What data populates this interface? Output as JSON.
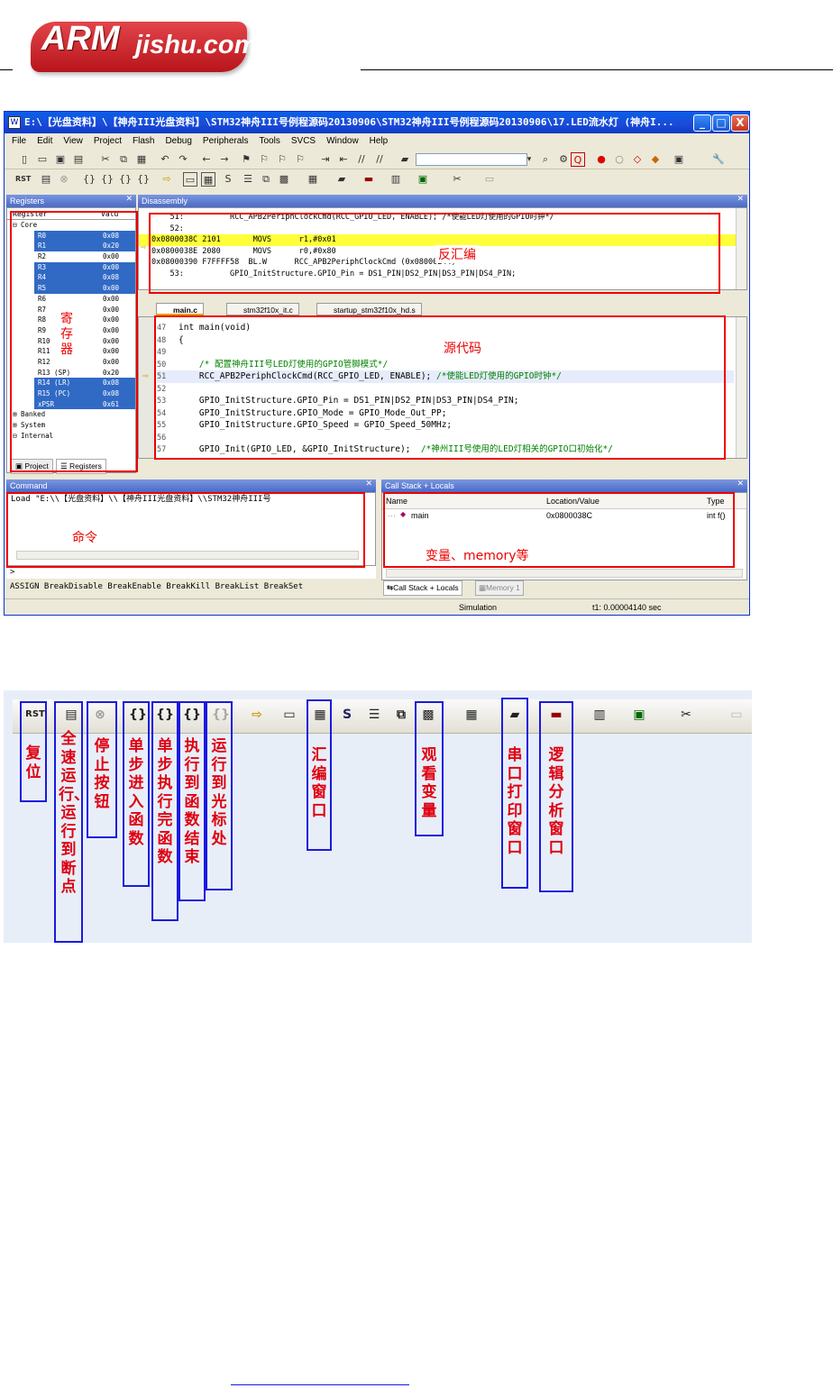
{
  "logo": {
    "arm": "ARM",
    "site": "jishu.com"
  },
  "window": {
    "title": "E:\\【光盘资料】\\【神舟III光盘资料】\\STM32神舟III号例程源码20130906\\STM32神舟III号例程源码20130906\\17.LED流水灯 (神舟I...",
    "buttons": [
      "_",
      "□",
      "X"
    ]
  },
  "menu": [
    "File",
    "Edit",
    "View",
    "Project",
    "Flash",
    "Debug",
    "Peripherals",
    "Tools",
    "SVCS",
    "Window",
    "Help"
  ],
  "registers": {
    "pane_title": "Registers",
    "col_register": "Register",
    "col_value": "Valu",
    "groups": [
      "Core",
      "Banked",
      "System",
      "Internal"
    ],
    "rows": [
      {
        "n": "R0",
        "v": "0x08",
        "sel": true
      },
      {
        "n": "R1",
        "v": "0x20",
        "sel": true
      },
      {
        "n": "R2",
        "v": "0x00",
        "sel": false
      },
      {
        "n": "R3",
        "v": "0x00",
        "sel": true
      },
      {
        "n": "R4",
        "v": "0x08",
        "sel": true
      },
      {
        "n": "R5",
        "v": "0x00",
        "sel": true
      },
      {
        "n": "R6",
        "v": "0x00",
        "sel": false
      },
      {
        "n": "R7",
        "v": "0x00",
        "sel": false
      },
      {
        "n": "R8",
        "v": "0x00",
        "sel": false
      },
      {
        "n": "R9",
        "v": "0x00",
        "sel": false
      },
      {
        "n": "R10",
        "v": "0x00",
        "sel": false
      },
      {
        "n": "R11",
        "v": "0x00",
        "sel": false
      },
      {
        "n": "R12",
        "v": "0x00",
        "sel": false
      },
      {
        "n": "R13 (SP)",
        "v": "0x20",
        "sel": false
      },
      {
        "n": "R14 (LR)",
        "v": "0x08",
        "sel": true
      },
      {
        "n": "R15 (PC)",
        "v": "0x08",
        "sel": true
      },
      {
        "n": "xPSR",
        "v": "0x61",
        "sel": true
      }
    ],
    "tab_project": "Project",
    "tab_registers": "Registers",
    "annotation": "寄存器"
  },
  "disassembly": {
    "pane_title": "Disassembly",
    "lines": [
      "    51:          RCC_APB2PeriphClockCmd(RCC_GPIO_LED, ENABLE); /*使能LED灯使用的GPIO时钟*/",
      "    52:",
      "0x0800038C 2101       MOVS      r1,#0x01",
      "0x0800038E 2080       MOVS      r0,#0x80",
      "0x08000390 F7FFFF58  BL.W      RCC_APB2PeriphClockCmd (0x08000244)",
      "    53:          GPIO_InitStructure.GPIO_Pin = DS1_PIN|DS2_PIN|DS3_PIN|DS4_PIN;"
    ],
    "annotation": "反汇编"
  },
  "editor": {
    "tabs": [
      "main.c",
      "stm32f10x_it.c",
      "startup_stm32f10x_hd.s"
    ],
    "lines": [
      {
        "n": "47",
        "t": "int main(void)",
        "c": ""
      },
      {
        "n": "48",
        "t": "{",
        "c": ""
      },
      {
        "n": "49",
        "t": "",
        "c": ""
      },
      {
        "n": "50",
        "t": "    ",
        "c": "/* 配置神舟III号LED灯使用的GPIO管脚模式*/"
      },
      {
        "n": "51",
        "t": "    RCC_APB2PeriphClockCmd(RCC_GPIO_LED, ENABLE); ",
        "c": "/*使能LED灯使用的GPIO时钟*/"
      },
      {
        "n": "52",
        "t": "",
        "c": ""
      },
      {
        "n": "53",
        "t": "    GPIO_InitStructure.GPIO_Pin = DS1_PIN|DS2_PIN|DS3_PIN|DS4_PIN;",
        "c": ""
      },
      {
        "n": "54",
        "t": "    GPIO_InitStructure.GPIO_Mode = GPIO_Mode_Out_PP;",
        "c": ""
      },
      {
        "n": "55",
        "t": "    GPIO_InitStructure.GPIO_Speed = GPIO_Speed_50MHz;",
        "c": ""
      },
      {
        "n": "56",
        "t": "",
        "c": ""
      },
      {
        "n": "57",
        "t": "    GPIO_Init(GPIO_LED, &GPIO_InitStructure);  ",
        "c": "/*神州III号使用的LED灯相关的GPIO口初始化*/"
      }
    ],
    "annotation": "源代码"
  },
  "command": {
    "pane_title": "Command",
    "load_line": "Load \"E:\\\\【光盘资料】\\\\【神舟III光盘资料】\\\\STM32神舟III号",
    "prompt": ">",
    "hints": "ASSIGN BreakDisable BreakEnable BreakKill BreakList BreakSet",
    "annotation": "命令"
  },
  "callstack": {
    "pane_title": "Call Stack + Locals",
    "cols": [
      "Name",
      "Location/Value",
      "Type"
    ],
    "row": {
      "name": "main",
      "value": "0x0800038C",
      "type": "int f()"
    },
    "tab_callstack": "Call Stack + Locals",
    "tab_memory": "Memory 1",
    "annotation": "变量、memory等"
  },
  "statusbar": {
    "mode": "Simulation",
    "time": "t1: 0.00004140 sec"
  },
  "toolbar_figure": {
    "icons": [
      "reset-icon",
      "run-icon",
      "stop-icon",
      "step-into-icon",
      "step-over-icon",
      "step-out-icon",
      "run-to-cursor-icon",
      "arrow-icon",
      "command-window-icon",
      "disassembly-window-icon",
      "symbols-window-icon",
      "registers-window-icon",
      "call-stack-icon",
      "watch-window-icon",
      "memory-window-icon",
      "serial-window-icon",
      "analysis-window-icon",
      "trace-icon",
      "system-viewer-icon",
      "toolbox-icon",
      "debug-restore-icon"
    ],
    "labels": {
      "reset": "复位",
      "run": "全速运行、运行到断点",
      "stop": "停止按钮",
      "step_into": "单步进入函数",
      "step_over": "单步执行完函数",
      "step_out": "执行到函数结束",
      "run_to_cursor": "运行到光标处",
      "disasm": "汇编窗口",
      "watch": "观看变量",
      "serial": "串口打印窗口",
      "logic": "逻辑分析窗口"
    }
  }
}
